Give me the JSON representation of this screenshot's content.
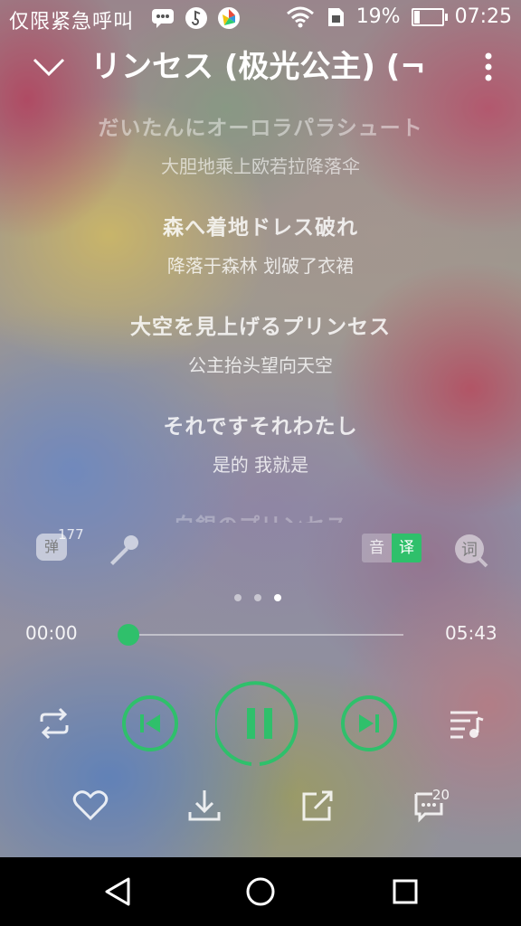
{
  "status_bar": {
    "carrier": "仅限紧急呼叫",
    "battery": "19%",
    "battery_level": 0.19,
    "time": "07:25"
  },
  "header": {
    "title": "リンセス (极光公主) (¬",
    "back_icon": "chevron-down-icon",
    "more_icon": "more-vertical-icon"
  },
  "lyrics": [
    {
      "jp": "だいたんにオーロラパラシュート",
      "cn": "大胆地乘上欧若拉降落伞"
    },
    {
      "jp": "森へ着地ドレス破れ",
      "cn": "降落于森林 划破了衣裙"
    },
    {
      "jp": "大空を見上げるプリンセス",
      "cn": "公主抬头望向天空"
    },
    {
      "jp": "それですそれわたし",
      "cn": "是的 我就是"
    },
    {
      "jp": "白銀のプリンセス",
      "cn": ""
    }
  ],
  "tools": {
    "danmu_label": "弹",
    "danmu_count": "177",
    "yin_label": "音",
    "yi_label": "译",
    "ci_label": "词"
  },
  "pager": {
    "count": 3,
    "active": 2
  },
  "progress": {
    "current": "00:00",
    "total": "05:43",
    "fraction": 0.0
  },
  "actions": {
    "comment_count": "20"
  },
  "colors": {
    "accent": "#2fc06b",
    "nav_bar": "#000000"
  }
}
